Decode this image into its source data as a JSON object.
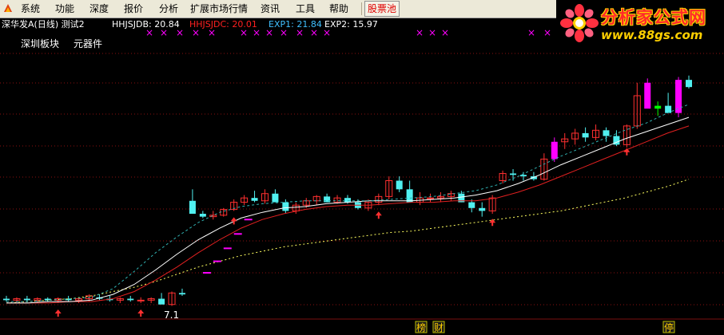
{
  "menu": {
    "items": [
      "系统",
      "功能",
      "深度",
      "报价",
      "分析",
      "扩展市场行情",
      "资讯",
      "工具",
      "帮助"
    ],
    "stock_pool": "股票池"
  },
  "brand": {
    "title": "分析家公式网",
    "url": "www.88gs.com"
  },
  "info": {
    "stock": "深华发A(日线) 测试2",
    "indicators": [
      {
        "text": "HHJSJDB: 20.84",
        "color": "#FFFFFF"
      },
      {
        "text": "HHJSJDC: 20.01",
        "color": "#FF2020"
      },
      {
        "text": "EXP1: 21.84",
        "color": "#40C0FF"
      },
      {
        "text": "EXP2: 15.97",
        "color": "#FFFFFF"
      }
    ]
  },
  "sublabels": [
    "深圳板块",
    "元器件"
  ],
  "colors": {
    "up": "#FF3030",
    "down": "#50F0F0",
    "grid": "#8A1010",
    "magenta": "#FF00FF",
    "green": "#00FF00",
    "yellow": "#FFFF60",
    "white": "#FFFFFF",
    "red": "#E02020",
    "cyan_dash": "#30B0B0"
  },
  "bottom_markers": [
    {
      "text": "榜",
      "slot": "a"
    },
    {
      "text": "财",
      "slot": "b"
    },
    {
      "text": "停",
      "slot": "c"
    }
  ],
  "bottom_label": "7.1",
  "chart_data": {
    "type": "candlestick",
    "y_range_price": [
      6.0,
      25.0
    ],
    "candles": [
      [
        7.3,
        7.5,
        7.1,
        7.2
      ],
      [
        7.2,
        7.4,
        7.0,
        7.3
      ],
      [
        7.3,
        7.5,
        7.1,
        7.2
      ],
      [
        7.2,
        7.4,
        7.0,
        7.3
      ],
      [
        7.3,
        7.4,
        7.1,
        7.2
      ],
      [
        7.2,
        7.4,
        7.0,
        7.3
      ],
      [
        7.3,
        7.5,
        7.1,
        7.2
      ],
      [
        7.2,
        7.4,
        7.0,
        7.3
      ],
      [
        7.3,
        7.6,
        7.1,
        7.5
      ],
      [
        7.4,
        7.6,
        7.2,
        7.3
      ],
      [
        7.3,
        7.5,
        7.1,
        7.2
      ],
      [
        7.2,
        7.4,
        7.0,
        7.3
      ],
      [
        7.3,
        7.5,
        7.1,
        7.2
      ],
      [
        7.2,
        7.4,
        7.0,
        7.2
      ],
      [
        7.2,
        7.4,
        7.0,
        7.3
      ],
      [
        7.3,
        7.7,
        7.0,
        6.9
      ],
      [
        6.9,
        7.8,
        6.8,
        7.7
      ],
      [
        7.7,
        8.0,
        7.5,
        7.6
      ],
      [
        14.1,
        14.9,
        13.9,
        13.2
      ],
      [
        13.2,
        13.4,
        12.9,
        13.0
      ],
      [
        13.0,
        13.4,
        12.8,
        13.1
      ],
      [
        13.1,
        13.6,
        13.0,
        13.5
      ],
      [
        13.5,
        14.2,
        13.4,
        14.0
      ],
      [
        14.0,
        14.5,
        13.8,
        14.3
      ],
      [
        14.3,
        14.8,
        14.0,
        14.1
      ],
      [
        14.1,
        14.9,
        13.9,
        14.6
      ],
      [
        14.6,
        14.9,
        14.2,
        14.0
      ],
      [
        14.0,
        14.2,
        13.2,
        13.4
      ],
      [
        13.4,
        14.0,
        13.2,
        13.8
      ],
      [
        13.8,
        14.3,
        13.6,
        14.1
      ],
      [
        14.1,
        14.5,
        13.8,
        14.4
      ],
      [
        14.4,
        14.6,
        14.0,
        14.0
      ],
      [
        14.0,
        14.5,
        13.9,
        14.3
      ],
      [
        14.3,
        14.5,
        13.9,
        14.0
      ],
      [
        14.0,
        14.2,
        13.5,
        13.6
      ],
      [
        13.6,
        14.2,
        13.4,
        14.0
      ],
      [
        14.0,
        14.6,
        13.8,
        14.4
      ],
      [
        14.4,
        15.8,
        14.2,
        15.5
      ],
      [
        15.5,
        15.8,
        14.7,
        14.9
      ],
      [
        14.9,
        15.5,
        14.5,
        14.0
      ],
      [
        14.0,
        14.7,
        13.8,
        14.3
      ],
      [
        14.3,
        14.6,
        14.0,
        14.3
      ],
      [
        14.3,
        14.7,
        14.0,
        14.4
      ],
      [
        14.4,
        14.8,
        14.1,
        14.6
      ],
      [
        14.6,
        14.8,
        14.0,
        14.0
      ],
      [
        14.0,
        14.2,
        13.3,
        13.6
      ],
      [
        13.6,
        14.0,
        13.0,
        13.4
      ],
      [
        13.4,
        14.5,
        13.2,
        14.3
      ],
      [
        15.5,
        16.2,
        15.3,
        16.0
      ],
      [
        16.0,
        16.3,
        15.5,
        15.9
      ],
      [
        15.9,
        16.1,
        15.5,
        15.8
      ],
      [
        15.8,
        16.1,
        15.5,
        15.6
      ],
      [
        15.6,
        17.4,
        15.5,
        17.0
      ],
      [
        17.0,
        18.5,
        16.8,
        18.2
      ],
      [
        18.2,
        18.8,
        17.7,
        18.4
      ],
      [
        18.4,
        19.1,
        18.0,
        18.8
      ],
      [
        18.8,
        19.2,
        18.2,
        18.5
      ],
      [
        18.5,
        19.4,
        18.3,
        19.0
      ],
      [
        19.0,
        19.2,
        18.2,
        18.6
      ],
      [
        18.6,
        19.0,
        17.9,
        18.0
      ],
      [
        18.0,
        19.4,
        17.8,
        19.3
      ],
      [
        19.3,
        22.3,
        19.1,
        21.4
      ],
      [
        22.3,
        22.6,
        21.0,
        20.5
      ],
      [
        20.5,
        21.0,
        20.0,
        20.7
      ],
      [
        20.7,
        21.6,
        20.3,
        20.2
      ],
      [
        20.2,
        22.7,
        19.9,
        22.5
      ],
      [
        22.5,
        22.8,
        21.9,
        22.0
      ]
    ],
    "lines": {
      "exp2_white": [
        7.0,
        7.0,
        7.1,
        7.1,
        7.2,
        7.6,
        8.3,
        9.3,
        10.4,
        11.4,
        12.2,
        12.9,
        13.3,
        13.6,
        13.7,
        13.9,
        14.0,
        14.1,
        14.1,
        14.1,
        14.2,
        14.3,
        14.5,
        14.8,
        15.3,
        15.9,
        16.6,
        17.2,
        17.8,
        18.4,
        18.9,
        19.4,
        19.9
      ],
      "red": [
        7.0,
        7.0,
        7.0,
        7.1,
        7.1,
        7.3,
        7.8,
        8.6,
        9.5,
        10.5,
        11.4,
        12.2,
        12.8,
        13.2,
        13.5,
        13.7,
        13.8,
        13.8,
        13.9,
        14.0,
        14.0,
        14.1,
        14.1,
        14.3,
        14.7,
        15.2,
        15.8,
        16.4,
        17.0,
        17.6,
        18.2,
        18.8,
        19.3
      ],
      "dotted_yellow": [
        7.0,
        7.1,
        7.2,
        7.3,
        7.5,
        7.8,
        8.1,
        8.5,
        9.0,
        9.5,
        9.9,
        10.3,
        10.6,
        10.9,
        11.1,
        11.3,
        11.5,
        11.7,
        11.9,
        12.0,
        12.2,
        12.4,
        12.6,
        12.8,
        13.0,
        13.2,
        13.4,
        13.7,
        14.0,
        14.3,
        14.7,
        15.1,
        15.6
      ],
      "cyan_dashed": [
        7.1,
        7.1,
        7.2,
        7.3,
        7.4,
        8.0,
        9.2,
        10.5,
        11.6,
        12.6,
        13.3,
        13.7,
        13.9,
        14.0,
        14.1,
        14.1,
        14.1,
        14.1,
        14.2,
        14.3,
        14.4,
        14.6,
        14.8,
        15.2,
        15.8,
        16.5,
        17.2,
        17.8,
        18.4,
        19.0,
        19.5,
        20.2,
        20.8
      ]
    }
  }
}
